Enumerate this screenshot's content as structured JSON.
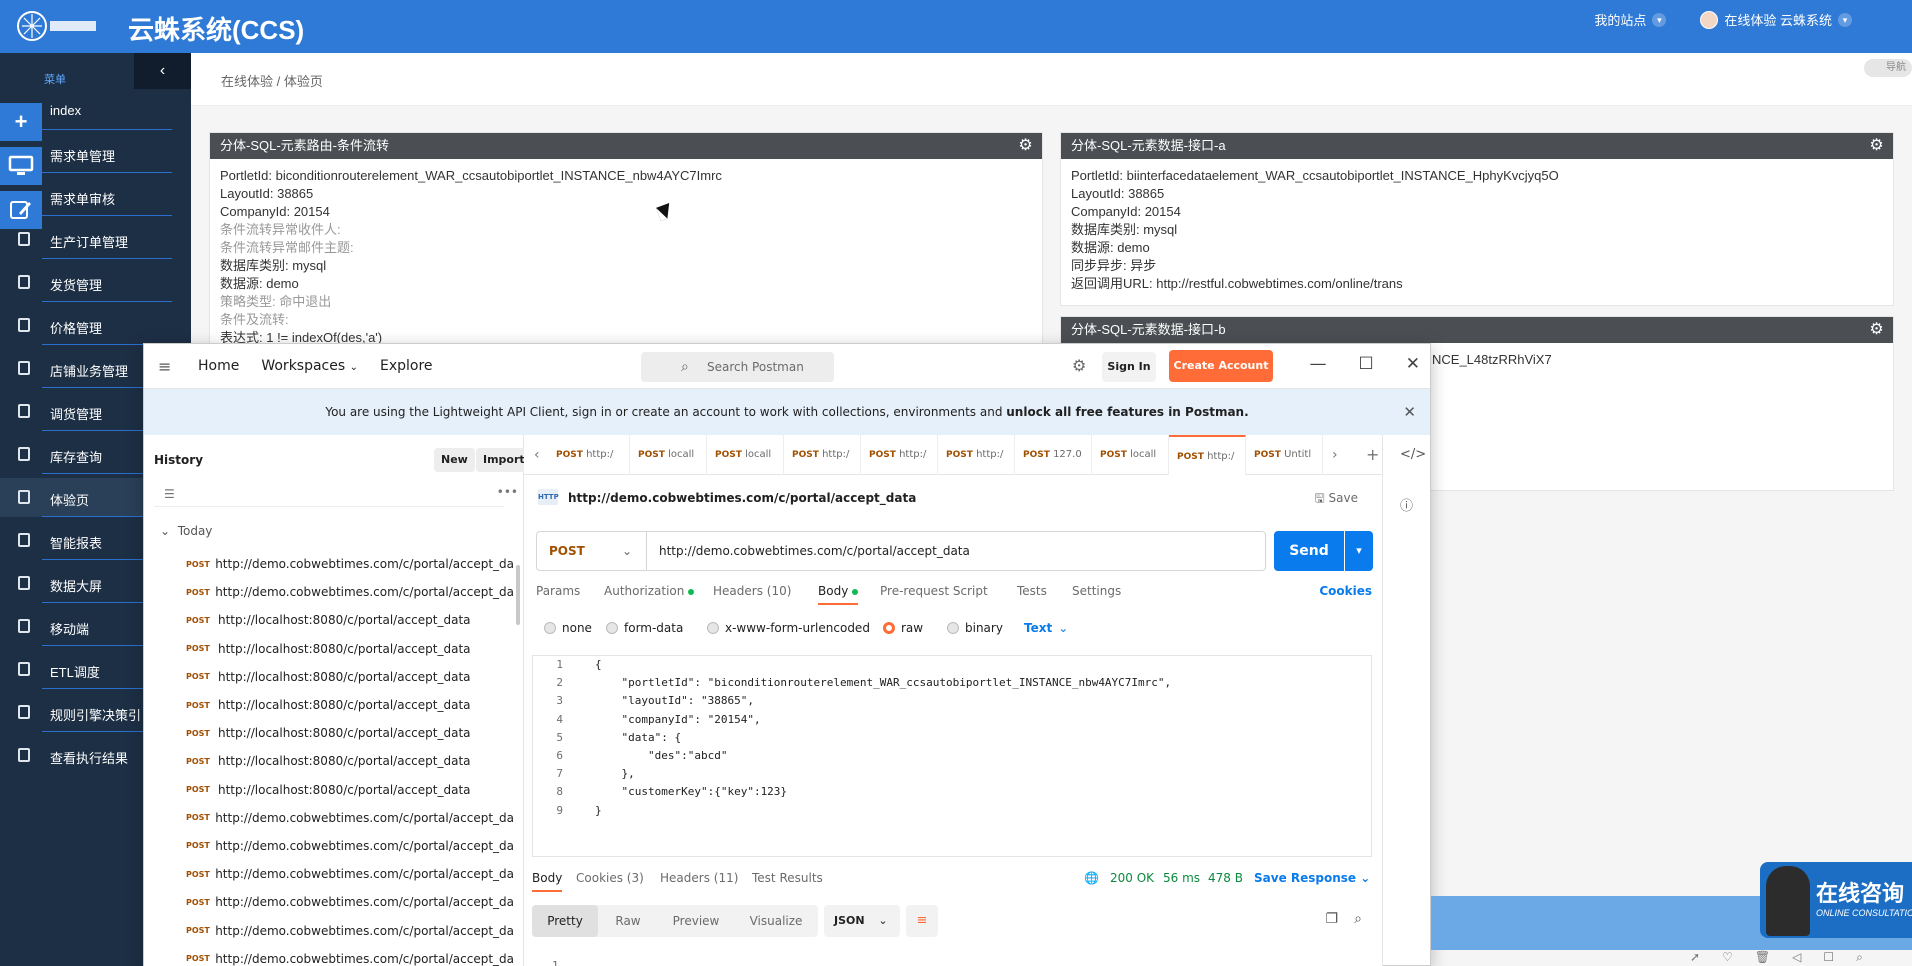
{
  "header": {
    "app_title": "云蛛系统(CCS)",
    "my_sites": "我的站点",
    "user": "在线体验 云蛛系统"
  },
  "sidebar": {
    "menu_label": "菜单",
    "items": [
      {
        "label": "index"
      },
      {
        "label": "需求单管理"
      },
      {
        "label": "需求单审核"
      },
      {
        "label": "生产订单管理"
      },
      {
        "label": "发货管理"
      },
      {
        "label": "价格管理"
      },
      {
        "label": "店铺业务管理"
      },
      {
        "label": "调货管理"
      },
      {
        "label": "库存查询"
      },
      {
        "label": "体验页"
      },
      {
        "label": "智能报表"
      },
      {
        "label": "数据大屏"
      },
      {
        "label": "移动端"
      },
      {
        "label": "ETL调度"
      },
      {
        "label": "规则引擎决策引"
      },
      {
        "label": "查看执行结果"
      }
    ]
  },
  "breadcrumb": {
    "text": "在线体验 / 体验页",
    "nav_mini": "导航"
  },
  "panels": {
    "left": {
      "title": "分体-SQL-元素路由-条件流转",
      "rows": [
        "PortletId: biconditionrouterelement_WAR_ccsautobiportlet_INSTANCE_nbw4AYC7Imrc",
        "LayoutId: 38865",
        "CompanyId: 20154",
        "条件流转异常收件人:",
        "条件流转异常邮件主题:",
        "数据库类别: mysql",
        "数据源: demo",
        "策略类型: 命中退出",
        "条件及流转:",
        "表达式: 1 != indexOf(des,'a')"
      ]
    },
    "right_a": {
      "title": "分体-SQL-元素数据-接口-a",
      "rows": [
        "PortletId: biinterfacedataelement_WAR_ccsautobiportlet_INSTANCE_HphyKvcjyq5O",
        "LayoutId: 38865",
        "CompanyId: 20154",
        "数据库类别: mysql",
        "数据源: demo",
        "同步异步: 异步",
        "返回调用URL: http://restful.cobwebtimes.com/online/trans"
      ]
    },
    "right_b": {
      "title": "分体-SQL-元素数据-接口-b",
      "rows": [
        "NCE_L48tzRRhViX7"
      ]
    }
  },
  "postman": {
    "nav": [
      "Home",
      "Workspaces",
      "Explore"
    ],
    "search_placeholder": "Search Postman",
    "sign_in": "Sign In",
    "create_account": "Create Account",
    "banner_pre": "You are using the Lightweight API Client, sign in or create an account to work with collections, environments and ",
    "banner_bold": "unlock all free features in Postman.",
    "history": {
      "title": "History",
      "new_btn": "New",
      "import_btn": "Import",
      "group": "Today",
      "items": [
        {
          "method": "POST",
          "url": "http://demo.cobwebtimes.com/c/portal/accept_da"
        },
        {
          "method": "POST",
          "url": "http://demo.cobwebtimes.com/c/portal/accept_da"
        },
        {
          "method": "POST",
          "url": "http://localhost:8080/c/portal/accept_data"
        },
        {
          "method": "POST",
          "url": "http://localhost:8080/c/portal/accept_data"
        },
        {
          "method": "POST",
          "url": "http://localhost:8080/c/portal/accept_data"
        },
        {
          "method": "POST",
          "url": "http://localhost:8080/c/portal/accept_data"
        },
        {
          "method": "POST",
          "url": "http://localhost:8080/c/portal/accept_data"
        },
        {
          "method": "POST",
          "url": "http://localhost:8080/c/portal/accept_data"
        },
        {
          "method": "POST",
          "url": "http://localhost:8080/c/portal/accept_data"
        },
        {
          "method": "POST",
          "url": "http://demo.cobwebtimes.com/c/portal/accept_da"
        },
        {
          "method": "POST",
          "url": "http://demo.cobwebtimes.com/c/portal/accept_da"
        },
        {
          "method": "POST",
          "url": "http://demo.cobwebtimes.com/c/portal/accept_da"
        },
        {
          "method": "POST",
          "url": "http://demo.cobwebtimes.com/c/portal/accept_da"
        },
        {
          "method": "POST",
          "url": "http://demo.cobwebtimes.com/c/portal/accept_da"
        },
        {
          "method": "POST",
          "url": "http://demo.cobwebtimes.com/c/portal/accept_da"
        }
      ]
    },
    "tabs": [
      {
        "method": "POST",
        "label": "http:/"
      },
      {
        "method": "POST",
        "label": "locall"
      },
      {
        "method": "POST",
        "label": "locall"
      },
      {
        "method": "POST",
        "label": "http:/"
      },
      {
        "method": "POST",
        "label": "http:/"
      },
      {
        "method": "POST",
        "label": "http:/"
      },
      {
        "method": "POST",
        "label": "127.0"
      },
      {
        "method": "POST",
        "label": "locall"
      },
      {
        "method": "POST",
        "label": "http:/"
      },
      {
        "method": "POST",
        "label": "Untitl"
      }
    ],
    "request": {
      "title": "http://demo.cobwebtimes.com/c/portal/accept_data",
      "save": "Save",
      "method": "POST",
      "url": "http://demo.cobwebtimes.com/c/portal/accept_data",
      "send": "Send"
    },
    "req_tabs": {
      "params": "Params",
      "authorization": "Authorization",
      "headers": "Headers (10)",
      "body": "Body",
      "pre_request": "Pre-request Script",
      "tests": "Tests",
      "settings": "Settings",
      "cookies": "Cookies"
    },
    "body_options": {
      "none": "none",
      "form_data": "form-data",
      "urlencoded": "x-www-form-urlencoded",
      "raw": "raw",
      "binary": "binary",
      "text": "Text"
    },
    "editor_lines": [
      "{",
      "    \"portletId\": \"biconditionrouterelement_WAR_ccsautobiportlet_INSTANCE_nbw4AYC7Imrc\",",
      "    \"layoutId\": \"38865\",",
      "    \"companyId\": \"20154\",",
      "    \"data\": {",
      "        \"des\":\"abcd\"",
      "    },",
      "    \"customerKey\":{\"key\":123}",
      "}"
    ],
    "response": {
      "body": "Body",
      "cookies": "Cookies (3)",
      "headers": "Headers (11)",
      "test_results": "Test Results",
      "status": "200 OK",
      "time": "56 ms",
      "size": "478 B",
      "save_response": "Save Response",
      "views": [
        "Pretty",
        "Raw",
        "Preview",
        "Visualize"
      ],
      "format": "JSON",
      "first_line_no": "1"
    }
  },
  "consult": {
    "title": "在线咨询",
    "subtitle": "ONLINE CONSULTATION"
  }
}
